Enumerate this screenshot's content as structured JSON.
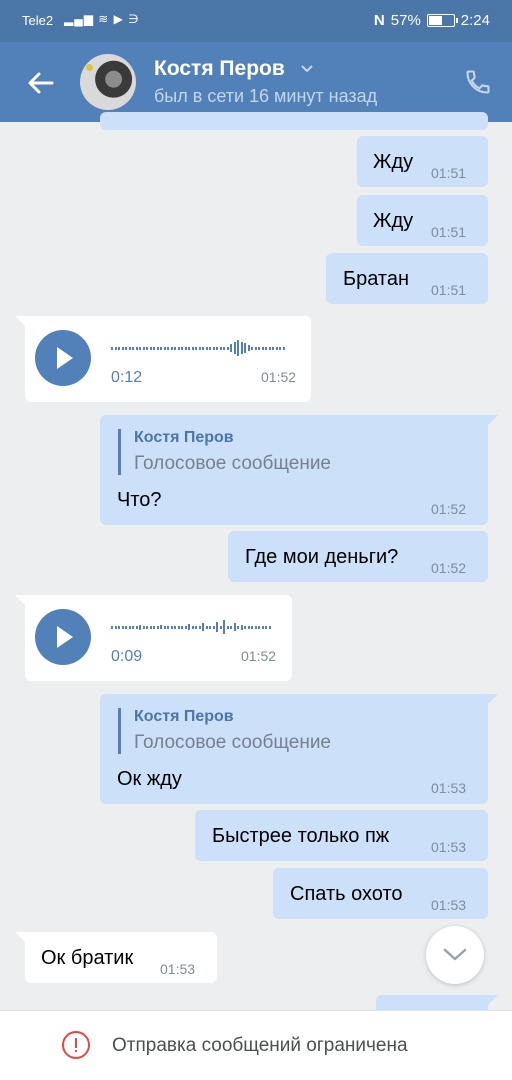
{
  "status_bar": {
    "carrier": "Tele2",
    "battery": "57%",
    "battery_level": 0.57,
    "time": "2:24"
  },
  "header": {
    "contact_name": "Костя Перов",
    "last_seen": "был в сети 16 минут назад"
  },
  "messages": [
    {
      "type": "text",
      "direction": "out",
      "text": "Жду",
      "time": "01:51"
    },
    {
      "type": "text",
      "direction": "out",
      "text": "Жду",
      "time": "01:51"
    },
    {
      "type": "text",
      "direction": "out",
      "text": "Братан",
      "time": "01:51"
    },
    {
      "type": "voice",
      "direction": "in",
      "duration": "0:12",
      "time": "01:52"
    },
    {
      "type": "reply",
      "direction": "out",
      "reply_author": "Костя Перов",
      "reply_type": "Голосовое сообщение",
      "text": "Что?",
      "time": "01:52"
    },
    {
      "type": "text",
      "direction": "out",
      "text": "Где мои деньги?",
      "time": "01:52"
    },
    {
      "type": "voice",
      "direction": "in",
      "duration": "0:09",
      "time": "01:52"
    },
    {
      "type": "reply",
      "direction": "out",
      "reply_author": "Костя Перов",
      "reply_type": "Голосовое сообщение",
      "text": "Ок жду",
      "time": "01:53"
    },
    {
      "type": "text",
      "direction": "out",
      "text": "Быстрее только пж",
      "time": "01:53"
    },
    {
      "type": "text",
      "direction": "out",
      "text": "Спать охото",
      "time": "01:53"
    },
    {
      "type": "text",
      "direction": "in",
      "text": "Ок братик",
      "time": "01:53"
    }
  ],
  "footer": {
    "notice": "Отправка сообщений ограничена"
  },
  "icons": [
    "back-arrow-icon",
    "chevron-down-icon",
    "phone-icon",
    "play-icon",
    "scroll-down-icon",
    "warning-icon"
  ],
  "colors": {
    "header": "#5181b8",
    "status_bar": "#4a76a8",
    "outgoing_bubble": "#cce0f9",
    "incoming_bubble": "#ffffff",
    "background": "#edeef0",
    "warning": "#e64646"
  }
}
